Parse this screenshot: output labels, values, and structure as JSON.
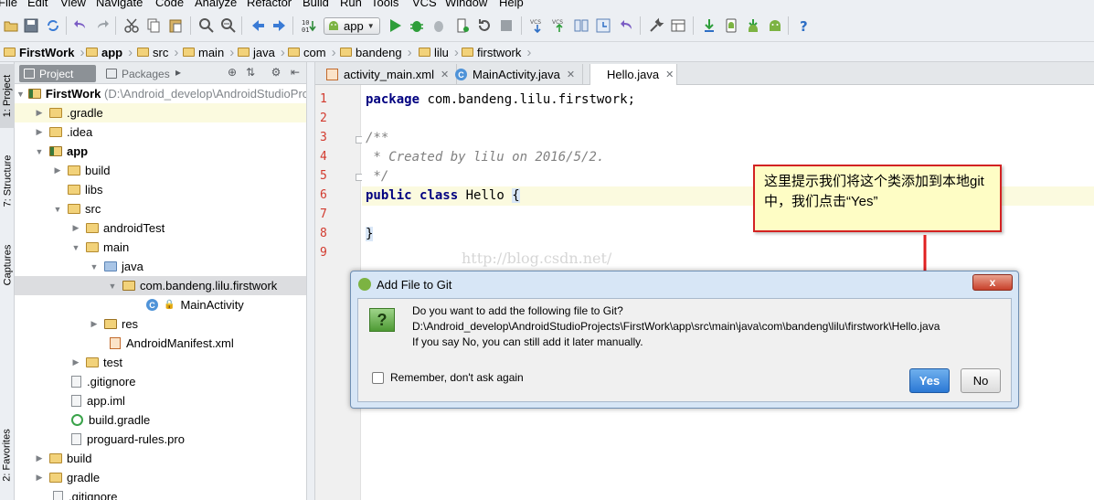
{
  "menu": [
    "File",
    "Edit",
    "View",
    "Navigate",
    "Code",
    "Analyze",
    "Refactor",
    "Build",
    "Run",
    "Tools",
    "VCS",
    "Window",
    "Help"
  ],
  "toolbar": {
    "run_config": "app",
    "icons": [
      "open-icon",
      "save-icon",
      "sync-icon",
      "undo-icon",
      "redo-icon",
      "cut-icon",
      "copy-icon",
      "paste-icon",
      "find-icon",
      "replace-icon",
      "back-icon",
      "forward-icon",
      "make-icon",
      "run-icon",
      "debug-icon",
      "attach-debugger-icon",
      "stop-icon",
      "vcs-update-icon",
      "vcs-commit-icon",
      "compare-icon",
      "revert-icon",
      "sdk-manager-icon",
      "avd-manager-icon",
      "sync-gradle-icon",
      "android-monitor-icon",
      "help-icon"
    ]
  },
  "breadcrumbs": [
    "FirstWork",
    "app",
    "src",
    "main",
    "java",
    "com",
    "bandeng",
    "lilu",
    "firstwork"
  ],
  "project_panel": {
    "tab_project": "Project",
    "tab_packages": "Packages",
    "tree": [
      {
        "label": "FirstWork",
        "suffix": "(D:\\Android_develop\\AndroidStudioProjects\\FirstWork)",
        "bold": true
      },
      {
        "label": ".gradle"
      },
      {
        "label": ".idea"
      },
      {
        "label": "app",
        "bold": true
      },
      {
        "label": "build"
      },
      {
        "label": "libs"
      },
      {
        "label": "src"
      },
      {
        "label": "androidTest"
      },
      {
        "label": "main"
      },
      {
        "label": "java"
      },
      {
        "label": "com.bandeng.lilu.firstwork"
      },
      {
        "label": "MainActivity"
      },
      {
        "label": "res"
      },
      {
        "label": "AndroidManifest.xml"
      },
      {
        "label": "test"
      },
      {
        "label": ".gitignore"
      },
      {
        "label": "app.iml"
      },
      {
        "label": "build.gradle"
      },
      {
        "label": "proguard-rules.pro"
      },
      {
        "label": "build"
      },
      {
        "label": "gradle"
      },
      {
        "label": ".gitignore"
      }
    ]
  },
  "side_tabs": {
    "project": "1: Project",
    "structure": "7: Structure",
    "captures": "Captures",
    "favorites": "2: Favorites"
  },
  "editor": {
    "tabs": [
      {
        "label": "activity_main.xml"
      },
      {
        "label": "MainActivity.java"
      },
      {
        "label": "Hello.java",
        "active": true
      }
    ],
    "line_numbers": [
      "1",
      "2",
      "3",
      "4",
      "5",
      "6",
      "7",
      "8",
      "9"
    ],
    "code": {
      "l1_kw": "package",
      "l1_rest": " com.bandeng.lilu.firstwork;",
      "l3": "/**",
      "l4": " * Created by lilu on 2016/5/2.",
      "l5": " */",
      "l6_kw1": "public",
      "l6_kw2": "class",
      "l6_name": " Hello ",
      "l6_brace": "{",
      "l8_brace": "}"
    },
    "watermark": "http://blog.csdn.net/"
  },
  "callout": {
    "text": "这里提示我们将这个类添加到本地git中，我们点击“Yes”"
  },
  "dialog": {
    "title": "Add File to Git",
    "question": "Do you want to add the following file to Git?",
    "path": "D:\\Android_develop\\AndroidStudioProjects\\FirstWork\\app\\src\\main\\java\\com\\bandeng\\lilu\\firstwork\\Hello.java",
    "hint": "If you say No, you can still add it later manually.",
    "remember": "Remember, don't ask again",
    "yes": "Yes",
    "no": "No",
    "close": "x"
  },
  "colors": {
    "accent": "#2b78d4",
    "callout_border": "#d32222",
    "callout_bg": "#fefdc5",
    "line_number": "#d23a2e",
    "keyword": "#000080"
  }
}
